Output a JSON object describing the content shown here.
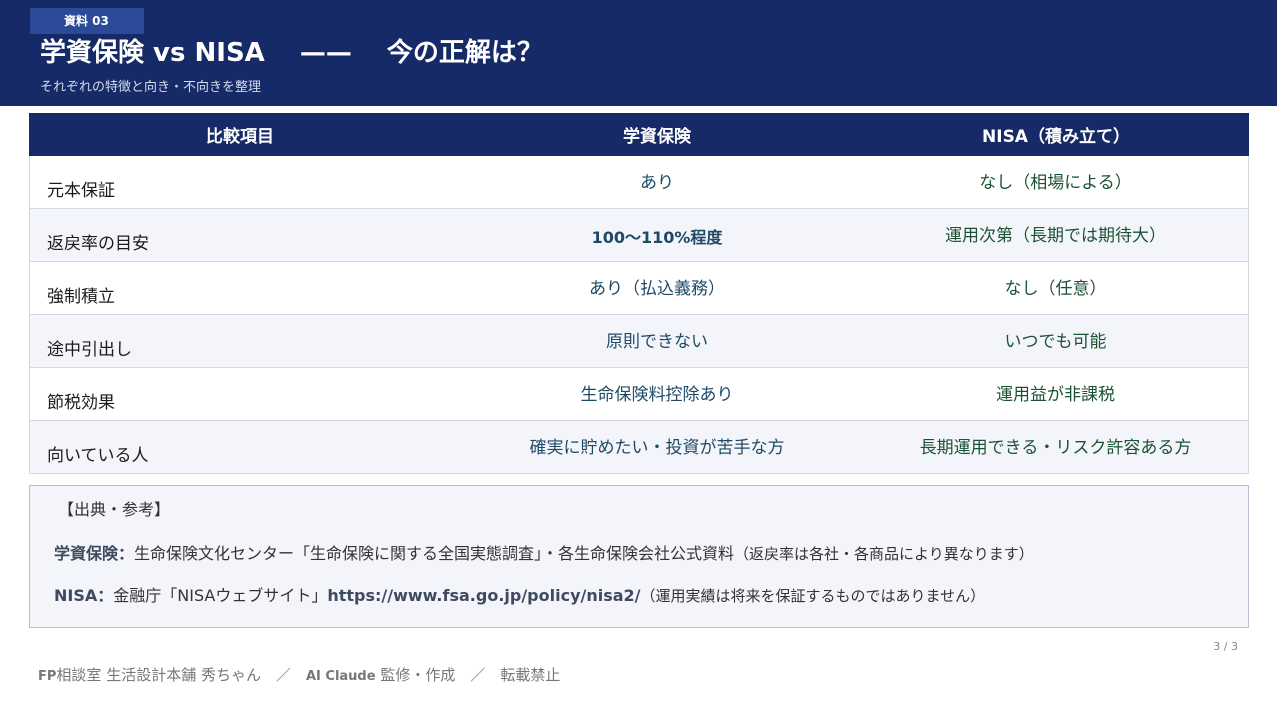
{
  "header": {
    "badge": "資料 03",
    "title": "学資保険 vs NISA　 ——　 今の正解は？",
    "subtitle": "それぞれの特徴と向き・不向きを整理"
  },
  "table": {
    "columns": [
      "比較項目",
      "学資保険",
      "NISA（積み立て）"
    ],
    "rows": [
      [
        "元本保証",
        "あり",
        "なし（相場による）"
      ],
      [
        "返戻率の目安",
        "100〜110%程度",
        "運用次第（長期では期待大）"
      ],
      [
        "強制積立",
        "あり（払込義務）",
        "なし（任意）"
      ],
      [
        "途中引出し",
        "原則できない",
        "いつでも可能"
      ],
      [
        "節税効果",
        "生命保険料控除あり",
        "運用益が非課税"
      ],
      [
        "向いている人",
        "確実に貯めたい・投資が苦手な方",
        "長期運用できる・リスク許容ある方"
      ]
    ]
  },
  "sources": {
    "title": "【出典・参考】",
    "line1": {
      "label": "学資保険：",
      "text": "生命保険文化センター「生命保険に関する全国実態調査」・各生命保険会社公式資料",
      "note": "（返戻率は各社・各商品により異なります）"
    },
    "line2": {
      "label": "NISA：",
      "text": "金融庁「NISAウェブサイト」",
      "url": "https://www.fsa.go.jp/policy/nisa2/",
      "note": "（運用実績は将来を保証するものではありません）"
    }
  },
  "page_number": "3 / 3",
  "footer": {
    "office_prefix": "FP",
    "office": "相談室 生活設計本舗 秀ちゃん",
    "sep1": "　／　",
    "ai_prefix": "AI Claude",
    "ai": " 監修・作成",
    "sep2": "　／　",
    "notice": "転載禁止"
  },
  "colors": {
    "header_bg": "#152a66",
    "badge_bg": "#2b4a98",
    "row_alt_bg": "#f3f5fa",
    "col2_text": "#1f4a66",
    "col3_text": "#1c5234"
  }
}
